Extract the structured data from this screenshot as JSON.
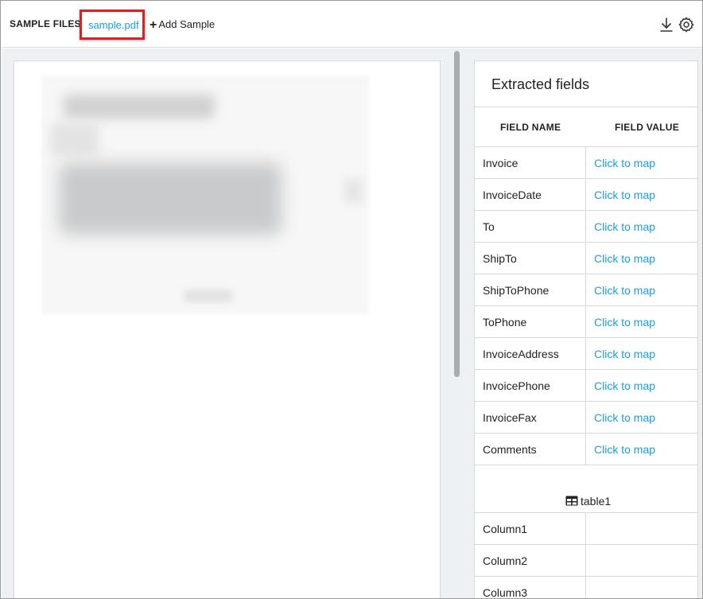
{
  "topbar": {
    "sample_files_label": "SAMPLE FILES:",
    "sample_file": "sample.pdf",
    "add_sample_label": "Add Sample",
    "icons": [
      "plus-icon",
      "download-icon",
      "gear-icon"
    ]
  },
  "fields_panel": {
    "title": "Extracted fields",
    "col_field_name": "FIELD NAME",
    "col_field_value": "FIELD VALUE",
    "fields": [
      {
        "name": "Invoice",
        "value": "Click to map"
      },
      {
        "name": "InvoiceDate",
        "value": "Click to map"
      },
      {
        "name": "To",
        "value": "Click to map"
      },
      {
        "name": "ShipTo",
        "value": "Click to map"
      },
      {
        "name": "ShipToPhone",
        "value": "Click to map"
      },
      {
        "name": "ToPhone",
        "value": "Click to map"
      },
      {
        "name": "InvoiceAddress",
        "value": "Click to map"
      },
      {
        "name": "InvoicePhone",
        "value": "Click to map"
      },
      {
        "name": "InvoiceFax",
        "value": "Click to map"
      },
      {
        "name": "Comments",
        "value": "Click to map"
      }
    ],
    "table": {
      "label": "table1",
      "icon": "table-icon",
      "columns": [
        "Column1",
        "Column2",
        "Column3"
      ]
    }
  },
  "colors": {
    "accent": "#1a9fd9",
    "highlight_border": "#e02020",
    "workspace_bg": "#eef1f3"
  }
}
